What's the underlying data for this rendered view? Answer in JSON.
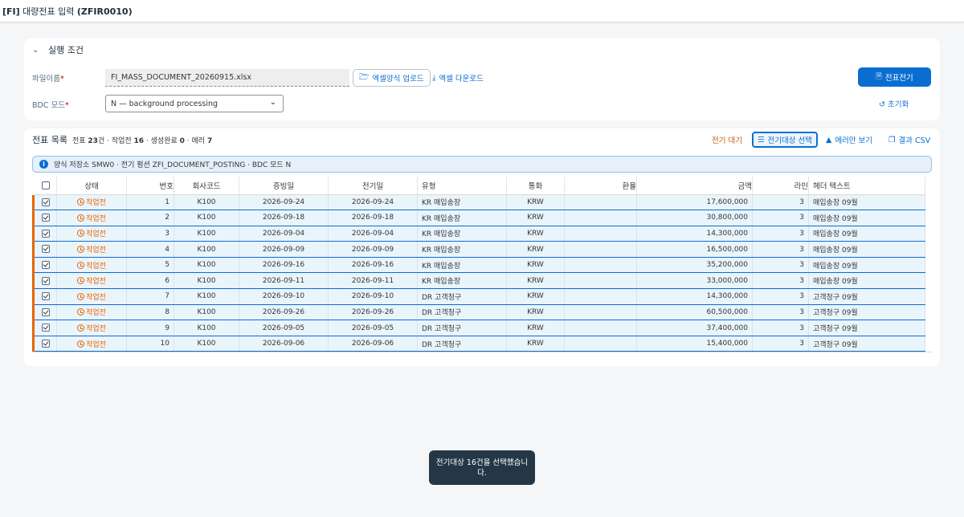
{
  "app": {
    "tag": "[FI]",
    "title": "대량전표 입력",
    "code": "(ZFIR0010)"
  },
  "conditions": {
    "section_title": "실행 조건",
    "file_label": "파일이름",
    "file_value": "FI_MASS_DOCUMENT_20260915.xlsx",
    "upload_label": "엑셀양식 업로드",
    "download_label": "엑셀 다운로드",
    "bdc_label": "BDC 모드",
    "bdc_value": "N — background processing",
    "post_button": "전표전기",
    "reset_button": "초기화"
  },
  "list": {
    "title": "전표 목록",
    "summary_prefix": "전표",
    "total": "23",
    "summary_mid1": "건 · 작업전",
    "pending": "16",
    "summary_mid2": " · 생성완료",
    "done": "0",
    "summary_mid3": " · 에러",
    "errors": "7",
    "toolbar": {
      "wait": "전기 대기",
      "select": "전기대상 선택",
      "errors_only": "에러만 보기",
      "csv": "결과 CSV"
    },
    "info": "양식 저장소 SMW0 · 전기 펑션 ZFI_DOCUMENT_POSTING · BDC 모드 N",
    "columns": [
      "상태",
      "번호",
      "회사코드",
      "증빙일",
      "전기일",
      "유형",
      "통화",
      "환율",
      "금액",
      "라인",
      "헤더 텍스트"
    ],
    "rows": [
      {
        "status": "작업전",
        "no": "1",
        "company": "K100",
        "doc_date": "2026-09-24",
        "post_date": "2026-09-24",
        "type": "KR 매입송장",
        "currency": "KRW",
        "rate": "",
        "amount": "17,600,000",
        "lines": "3",
        "header": "매입송장 09월"
      },
      {
        "status": "작업전",
        "no": "2",
        "company": "K100",
        "doc_date": "2026-09-18",
        "post_date": "2026-09-18",
        "type": "KR 매입송장",
        "currency": "KRW",
        "rate": "",
        "amount": "30,800,000",
        "lines": "3",
        "header": "매입송장 09월"
      },
      {
        "status": "작업전",
        "no": "3",
        "company": "K100",
        "doc_date": "2026-09-04",
        "post_date": "2026-09-04",
        "type": "KR 매입송장",
        "currency": "KRW",
        "rate": "",
        "amount": "14,300,000",
        "lines": "3",
        "header": "매입송장 09월"
      },
      {
        "status": "작업전",
        "no": "4",
        "company": "K100",
        "doc_date": "2026-09-09",
        "post_date": "2026-09-09",
        "type": "KR 매입송장",
        "currency": "KRW",
        "rate": "",
        "amount": "16,500,000",
        "lines": "3",
        "header": "매입송장 09월"
      },
      {
        "status": "작업전",
        "no": "5",
        "company": "K100",
        "doc_date": "2026-09-16",
        "post_date": "2026-09-16",
        "type": "KR 매입송장",
        "currency": "KRW",
        "rate": "",
        "amount": "35,200,000",
        "lines": "3",
        "header": "매입송장 09월"
      },
      {
        "status": "작업전",
        "no": "6",
        "company": "K100",
        "doc_date": "2026-09-11",
        "post_date": "2026-09-11",
        "type": "KR 매입송장",
        "currency": "KRW",
        "rate": "",
        "amount": "33,000,000",
        "lines": "3",
        "header": "매입송장 09월"
      },
      {
        "status": "작업전",
        "no": "7",
        "company": "K100",
        "doc_date": "2026-09-10",
        "post_date": "2026-09-10",
        "type": "DR 고객청구",
        "currency": "KRW",
        "rate": "",
        "amount": "14,300,000",
        "lines": "3",
        "header": "고객청구 09월"
      },
      {
        "status": "작업전",
        "no": "8",
        "company": "K100",
        "doc_date": "2026-09-26",
        "post_date": "2026-09-26",
        "type": "DR 고객청구",
        "currency": "KRW",
        "rate": "",
        "amount": "60,500,000",
        "lines": "3",
        "header": "고객청구 09월"
      },
      {
        "status": "작업전",
        "no": "9",
        "company": "K100",
        "doc_date": "2026-09-05",
        "post_date": "2026-09-05",
        "type": "DR 고객청구",
        "currency": "KRW",
        "rate": "",
        "amount": "37,400,000",
        "lines": "3",
        "header": "고객청구 09월"
      },
      {
        "status": "작업전",
        "no": "10",
        "company": "K100",
        "doc_date": "2026-09-06",
        "post_date": "2026-09-06",
        "type": "DR 고객청구",
        "currency": "KRW",
        "rate": "",
        "amount": "15,400,000",
        "lines": "3",
        "header": "고객청구 09월"
      }
    ]
  },
  "toast": "전기대상 16건을 선택했습니다.",
  "colors": {
    "accent": "#0a6ed1",
    "warning": "#e76500",
    "toast_bg": "#243746"
  }
}
